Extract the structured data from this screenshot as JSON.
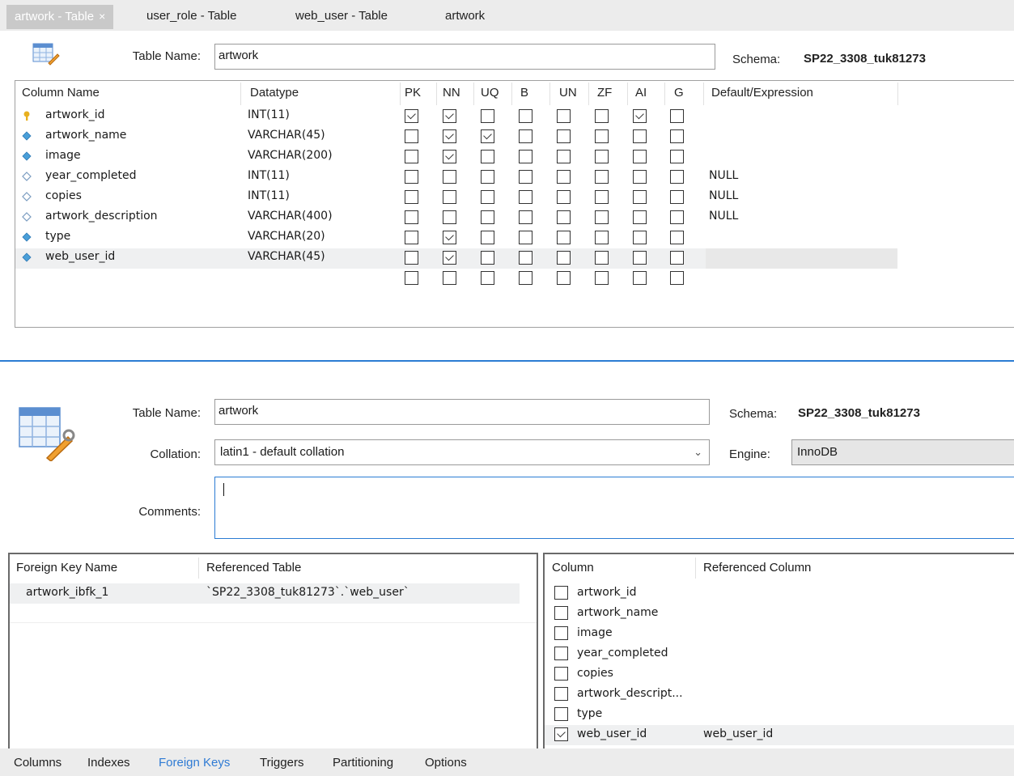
{
  "tabs": [
    {
      "label": "artwork - Table",
      "active": true
    },
    {
      "label": "user_role - Table",
      "active": false
    },
    {
      "label": "web_user - Table",
      "active": false
    },
    {
      "label": "artwork",
      "active": false
    }
  ],
  "top": {
    "table_name_label": "Table Name:",
    "table_name_value": "artwork",
    "schema_label": "Schema:",
    "schema_value": "SP22_3308_tuk81273"
  },
  "grid": {
    "headers": [
      "Column Name",
      "Datatype",
      "PK",
      "NN",
      "UQ",
      "B",
      "UN",
      "ZF",
      "AI",
      "G",
      "Default/Expression"
    ],
    "rows": [
      {
        "name": "artwork_id",
        "type": "INT(11)",
        "icon": "primary-key-icon",
        "flags": [
          1,
          1,
          0,
          0,
          0,
          0,
          1,
          0
        ],
        "default": ""
      },
      {
        "name": "artwork_name",
        "type": "VARCHAR(45)",
        "icon": "column-nn-icon",
        "flags": [
          0,
          1,
          1,
          0,
          0,
          0,
          0,
          0
        ],
        "default": ""
      },
      {
        "name": "image",
        "type": "VARCHAR(200)",
        "icon": "column-nn-icon",
        "flags": [
          0,
          1,
          0,
          0,
          0,
          0,
          0,
          0
        ],
        "default": ""
      },
      {
        "name": "year_completed",
        "type": "INT(11)",
        "icon": "column-nullable-icon",
        "flags": [
          0,
          0,
          0,
          0,
          0,
          0,
          0,
          0
        ],
        "default": "NULL"
      },
      {
        "name": "copies",
        "type": "INT(11)",
        "icon": "column-nullable-icon",
        "flags": [
          0,
          0,
          0,
          0,
          0,
          0,
          0,
          0
        ],
        "default": "NULL"
      },
      {
        "name": "artwork_description",
        "type": "VARCHAR(400)",
        "icon": "column-nullable-icon",
        "flags": [
          0,
          0,
          0,
          0,
          0,
          0,
          0,
          0
        ],
        "default": "NULL"
      },
      {
        "name": "type",
        "type": "VARCHAR(20)",
        "icon": "column-nn-icon",
        "flags": [
          0,
          1,
          0,
          0,
          0,
          0,
          0,
          0
        ],
        "default": ""
      },
      {
        "name": "web_user_id",
        "type": "VARCHAR(45)",
        "icon": "column-nn-icon",
        "flags": [
          0,
          1,
          0,
          0,
          0,
          0,
          0,
          0
        ],
        "default": ""
      },
      {
        "name": "",
        "type": "",
        "icon": "",
        "flags": [
          0,
          0,
          0,
          0,
          0,
          0,
          0,
          0
        ],
        "default": ""
      }
    ]
  },
  "details": {
    "table_name_label": "Table Name:",
    "table_name_value": "artwork",
    "schema_label": "Schema:",
    "schema_value": "SP22_3308_tuk81273",
    "collation_label": "Collation:",
    "collation_value": "latin1 - default collation",
    "engine_label": "Engine:",
    "engine_value": "InnoDB",
    "comments_label": "Comments:",
    "comments_value": ""
  },
  "fk": {
    "headers": [
      "Foreign Key Name",
      "Referenced Table"
    ],
    "rows": [
      {
        "name": "artwork_ibfk_1",
        "table": "`SP22_3308_tuk81273`.`web_user`"
      }
    ]
  },
  "fkcols": {
    "headers": [
      "Column",
      "Referenced Column"
    ],
    "rows": [
      {
        "column": "artwork_id",
        "checked": false,
        "ref": ""
      },
      {
        "column": "artwork_name",
        "checked": false,
        "ref": ""
      },
      {
        "column": "image",
        "checked": false,
        "ref": ""
      },
      {
        "column": "year_completed",
        "checked": false,
        "ref": ""
      },
      {
        "column": "copies",
        "checked": false,
        "ref": ""
      },
      {
        "column": "artwork_descript...",
        "checked": false,
        "ref": ""
      },
      {
        "column": "type",
        "checked": false,
        "ref": ""
      },
      {
        "column": "web_user_id",
        "checked": true,
        "ref": "web_user_id"
      }
    ]
  },
  "bottom_tabs": [
    {
      "label": "Columns",
      "active": false
    },
    {
      "label": "Indexes",
      "active": false
    },
    {
      "label": "Foreign Keys",
      "active": true
    },
    {
      "label": "Triggers",
      "active": false
    },
    {
      "label": "Partitioning",
      "active": false
    },
    {
      "label": "Options",
      "active": false
    }
  ],
  "colors": {
    "accent": "#2f7bd4",
    "divider": "#2b7cd3",
    "key": "#e8b020",
    "nn": "#4a9fd8"
  }
}
